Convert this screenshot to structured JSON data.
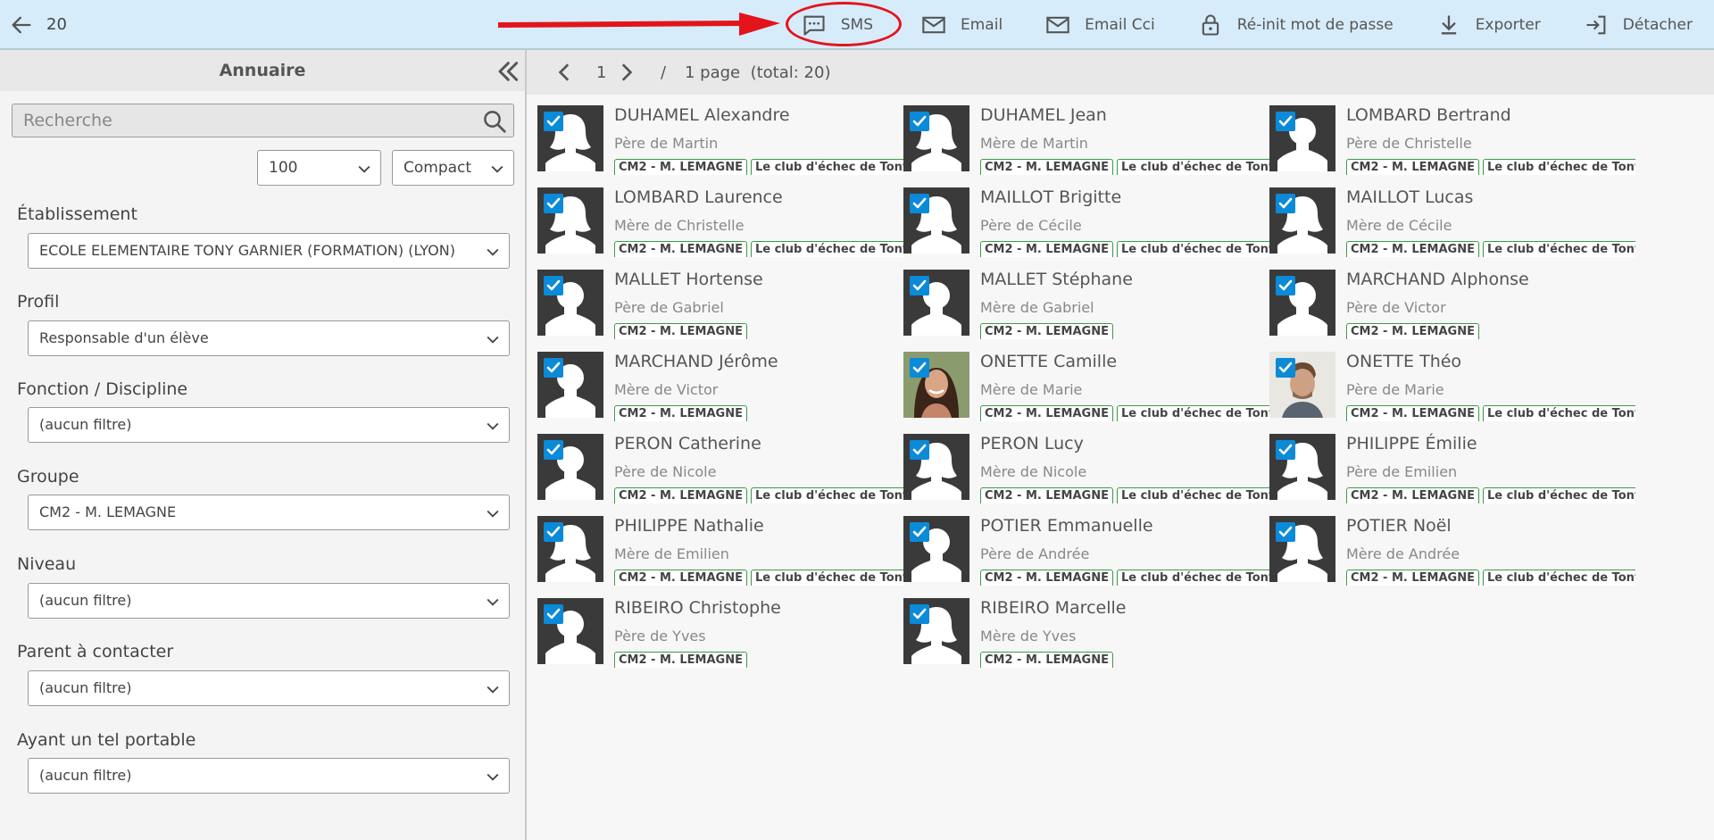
{
  "topbar": {
    "count": "20",
    "actions": [
      {
        "label": "SMS",
        "icon": "sms-icon"
      },
      {
        "label": "Email",
        "icon": "mail-icon"
      },
      {
        "label": "Email Cci",
        "icon": "mail-bcc-icon"
      },
      {
        "label": "Ré-init mot de passe",
        "icon": "lock-icon"
      },
      {
        "label": "Exporter",
        "icon": "download-icon"
      },
      {
        "label": "Détacher",
        "icon": "detach-icon"
      }
    ],
    "annotation_color": "#e3141c"
  },
  "sidebar": {
    "title": "Annuaire",
    "search_placeholder": "Recherche",
    "page_size": "100",
    "display_mode": "Compact",
    "filters": [
      {
        "label": "Établissement",
        "value": "ECOLE ELEMENTAIRE TONY GARNIER (FORMATION) (LYON)"
      },
      {
        "label": "Profil",
        "value": "Responsable d'un élève"
      },
      {
        "label": "Fonction / Discipline",
        "value": "(aucun filtre)"
      },
      {
        "label": "Groupe",
        "value": "CM2 - M. LEMAGNE"
      },
      {
        "label": "Niveau",
        "value": "(aucun filtre)"
      },
      {
        "label": "Parent à contacter",
        "value": "(aucun filtre)"
      },
      {
        "label": "Ayant un tel portable",
        "value": "(aucun filtre)"
      }
    ]
  },
  "pager": {
    "page": "1",
    "separator": "/",
    "info": "1 page  (total: 20)"
  },
  "colors": {
    "topbar": "#d7ecfa",
    "check": "#0b8ad8",
    "tag_border": "#3c9a48"
  },
  "contacts": [
    {
      "name": "DUHAMEL Alexandre",
      "role": "Père de Martin",
      "tags": [
        "CM2 - M. LEMAGNE",
        "Le club d'échec de Tony"
      ],
      "avatar": "female"
    },
    {
      "name": "DUHAMEL Jean",
      "role": "Mère de Martin",
      "tags": [
        "CM2 - M. LEMAGNE",
        "Le club d'échec de Tony"
      ],
      "avatar": "female"
    },
    {
      "name": "LOMBARD Bertrand",
      "role": "Père de Christelle",
      "tags": [
        "CM2 - M. LEMAGNE",
        "Le club d'échec de Tony"
      ],
      "avatar": "male"
    },
    {
      "name": "LOMBARD Laurence",
      "role": "Mère de Christelle",
      "tags": [
        "CM2 - M. LEMAGNE",
        "Le club d'échec de Tony"
      ],
      "avatar": "female"
    },
    {
      "name": "MAILLOT Brigitte",
      "role": "Père de Cécile",
      "tags": [
        "CM2 - M. LEMAGNE",
        "Le club d'échec de Tony"
      ],
      "avatar": "female"
    },
    {
      "name": "MAILLOT Lucas",
      "role": "Mère de Cécile",
      "tags": [
        "CM2 - M. LEMAGNE",
        "Le club d'échec de Tony"
      ],
      "avatar": "female"
    },
    {
      "name": "MALLET Hortense",
      "role": "Père de Gabriel",
      "tags": [
        "CM2 - M. LEMAGNE"
      ],
      "avatar": "male"
    },
    {
      "name": "MALLET Stéphane",
      "role": "Mère de Gabriel",
      "tags": [
        "CM2 - M. LEMAGNE"
      ],
      "avatar": "male"
    },
    {
      "name": "MARCHAND Alphonse",
      "role": "Père de Victor",
      "tags": [
        "CM2 - M. LEMAGNE"
      ],
      "avatar": "male"
    },
    {
      "name": "MARCHAND Jérôme",
      "role": "Mère de Victor",
      "tags": [
        "CM2 - M. LEMAGNE"
      ],
      "avatar": "male"
    },
    {
      "name": "ONETTE Camille",
      "role": "Mère de Marie",
      "tags": [
        "CM2 - M. LEMAGNE",
        "Le club d'échec de Tony"
      ],
      "avatar": "photo-woman"
    },
    {
      "name": "ONETTE Théo",
      "role": "Père de Marie",
      "tags": [
        "CM2 - M. LEMAGNE",
        "Le club d'échec de Tony"
      ],
      "avatar": "photo-man"
    },
    {
      "name": "PERON Catherine",
      "role": "Père de Nicole",
      "tags": [
        "CM2 - M. LEMAGNE",
        "Le club d'échec de Tony"
      ],
      "avatar": "male"
    },
    {
      "name": "PERON Lucy",
      "role": "Mère de Nicole",
      "tags": [
        "CM2 - M. LEMAGNE",
        "Le club d'échec de Tony"
      ],
      "avatar": "female"
    },
    {
      "name": "PHILIPPE Émilie",
      "role": "Père de Emilien",
      "tags": [
        "CM2 - M. LEMAGNE",
        "Le club d'échec de Tony"
      ],
      "avatar": "female"
    },
    {
      "name": "PHILIPPE Nathalie",
      "role": "Mère de Emilien",
      "tags": [
        "CM2 - M. LEMAGNE",
        "Le club d'échec de Tony"
      ],
      "avatar": "female"
    },
    {
      "name": "POTIER Emmanuelle",
      "role": "Père de Andrée",
      "tags": [
        "CM2 - M. LEMAGNE",
        "Le club d'échec de Tony"
      ],
      "avatar": "male"
    },
    {
      "name": "POTIER Noël",
      "role": "Mère de Andrée",
      "tags": [
        "CM2 - M. LEMAGNE",
        "Le club d'échec de Tony"
      ],
      "avatar": "female"
    },
    {
      "name": "RIBEIRO Christophe",
      "role": "Père de Yves",
      "tags": [
        "CM2 - M. LEMAGNE"
      ],
      "avatar": "male"
    },
    {
      "name": "RIBEIRO Marcelle",
      "role": "Mère de Yves",
      "tags": [
        "CM2 - M. LEMAGNE"
      ],
      "avatar": "female"
    }
  ]
}
